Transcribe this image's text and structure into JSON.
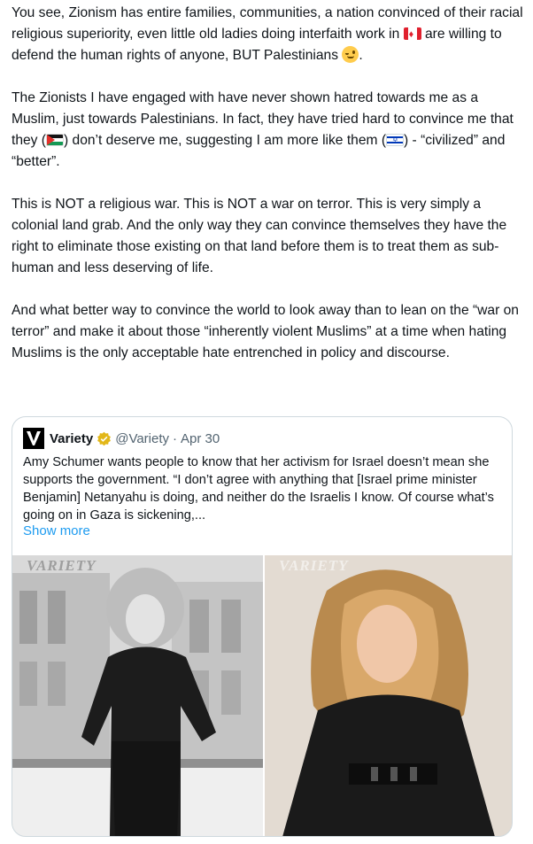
{
  "tweet": {
    "paragraphs": [
      {
        "p1": "You see, Zionism has entire families, communities, a nation convinced of their racial religious superiority, even little old ladies doing interfaith work in ",
        "p2": " are willing to defend the human rights of anyone, BUT Palestinians ",
        "p3": "."
      },
      {
        "p1": "The Zionists I have engaged with have never shown hatred towards me as a Muslim, just towards Palestinians. In fact, they have tried hard to convince me that they (",
        "p2": ") don’t deserve me, suggesting I am more like them (",
        "p3": ") - “civilized” and “better”."
      },
      {
        "text": "This is NOT a religious war. This is NOT a war on terror. This is very simply a colonial land grab. And the only way they can convince themselves they have the right to eliminate those existing on that land before them is to treat them as sub-human and less deserving of life."
      },
      {
        "text": "And what better way to convince the world to look away than to lean on the “war on terror” and make it about those “inherently violent Muslims” at a time when hating Muslims is the only acceptable hate entrenched in policy and discourse."
      }
    ],
    "emoji": {
      "flag_1": "canada-flag-icon",
      "wink": "winking-face-icon",
      "flag_2": "palestine-flag-icon",
      "flag_3": "israel-flag-icon"
    }
  },
  "quote": {
    "author_name": "Variety",
    "handle": "@Variety",
    "separator": "·",
    "date": "Apr 30",
    "text": "Amy Schumer wants people to know that her activism for Israel doesn’t mean she supports the government. “I don’t agree with anything that [Israel prime minister Benjamin] Netanyahu is doing, and neither do the Israelis I know. Of course what’s going on in Gaza is sickening,...",
    "show_more": "Show more",
    "watermark": "VARIETY"
  },
  "colors": {
    "text": "#0f1419",
    "secondary": "#536471",
    "link": "#1d9bf0",
    "border": "#cfd9de",
    "verified_gold": "#e2b719"
  }
}
